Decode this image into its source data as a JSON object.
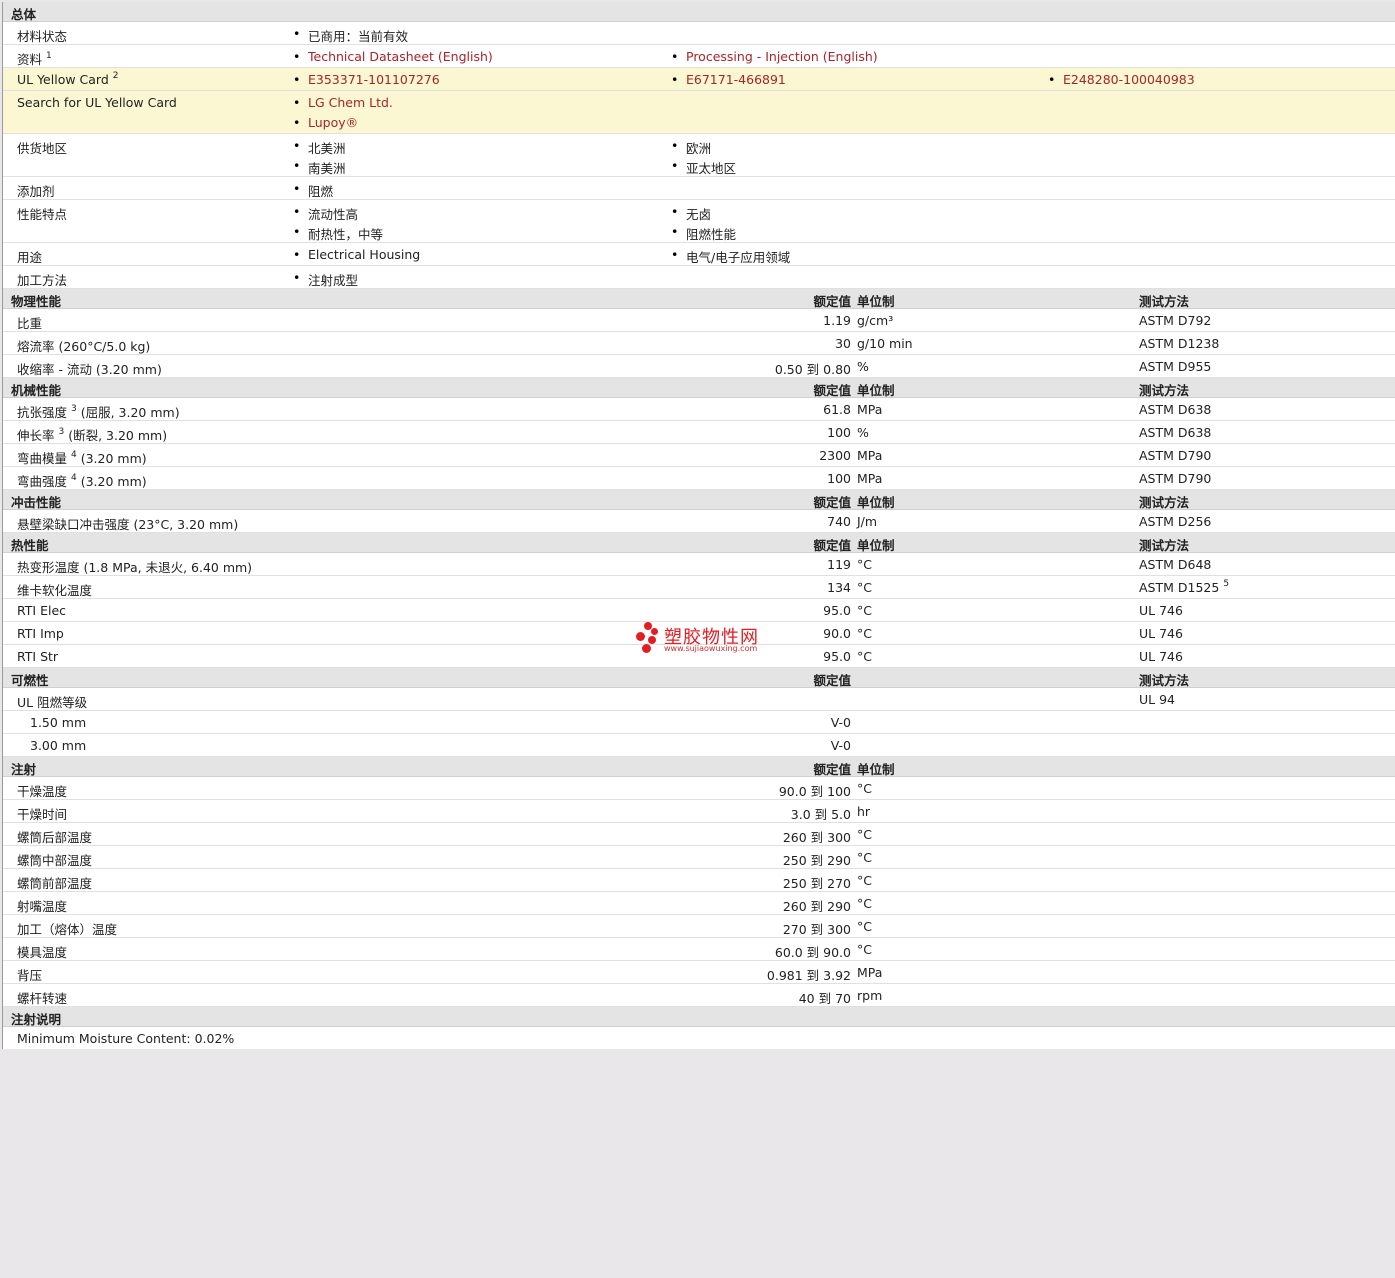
{
  "general": {
    "title": "总体",
    "status_label": "材料状态",
    "status_value": "已商用：当前有效",
    "docs_label": "资料",
    "docs_sup": "1",
    "docs": [
      "Technical Datasheet (English)",
      "Processing - Injection (English)"
    ],
    "ulcard_label": "UL Yellow Card",
    "ulcard_sup": "2",
    "ulcards": [
      "E353371-101107276",
      "E67171-466891",
      "E248280-100040983"
    ],
    "search_label": "Search for UL Yellow Card",
    "search_links": [
      "LG Chem Ltd.",
      "Lupoy®"
    ],
    "region_label": "供货地区",
    "regions": [
      "北美洲",
      "欧洲",
      "南美洲",
      "亚太地区"
    ],
    "additive_label": "添加剂",
    "additive": "阻燃",
    "features_label": "性能特点",
    "features": [
      "流动性高",
      "无卤",
      "耐热性，中等",
      "阻燃性能"
    ],
    "uses_label": "用途",
    "uses": [
      "Electrical Housing",
      "电气/电子应用领域"
    ],
    "process_label": "加工方法",
    "process": "注射成型"
  },
  "headers": {
    "value": "额定值",
    "unit": "单位制",
    "method": "测试方法"
  },
  "physical": {
    "title": "物理性能",
    "rows": [
      {
        "label": "比重",
        "value": "1.19",
        "unit": "g/cm³",
        "method": "ASTM D792"
      },
      {
        "label": "熔流率  (260°C/5.0 kg)",
        "value": "30",
        "unit": "g/10 min",
        "method": "ASTM D1238"
      },
      {
        "label": "收缩率  - 流动  (3.20 mm)",
        "value": "0.50 到  0.80",
        "unit": "%",
        "method": "ASTM D955"
      }
    ]
  },
  "mechanical": {
    "title": "机械性能",
    "rows": [
      {
        "label": "抗张强度",
        "sup": "3",
        "cond": "(屈服, 3.20 mm)",
        "value": "61.8",
        "unit": "MPa",
        "method": "ASTM D638"
      },
      {
        "label": "伸长率",
        "sup": "3",
        "cond": "(断裂, 3.20 mm)",
        "value": "100",
        "unit": "%",
        "method": "ASTM D638"
      },
      {
        "label": "弯曲模量",
        "sup": "4",
        "cond": "(3.20 mm)",
        "value": "2300",
        "unit": "MPa",
        "method": "ASTM D790"
      },
      {
        "label": "弯曲强度",
        "sup": "4",
        "cond": "(3.20 mm)",
        "value": "100",
        "unit": "MPa",
        "method": "ASTM D790"
      }
    ]
  },
  "impact": {
    "title": "冲击性能",
    "rows": [
      {
        "label": "悬壁梁缺口冲击强度  (23°C, 3.20 mm)",
        "value": "740",
        "unit": "J/m",
        "method": "ASTM D256"
      }
    ]
  },
  "thermal": {
    "title": "热性能",
    "rows": [
      {
        "label": "热变形温度  (1.8 MPa, 未退火, 6.40 mm)",
        "value": "119",
        "unit": "°C",
        "method": "ASTM D648"
      },
      {
        "label": "维卡软化温度",
        "value": "134",
        "unit": "°C",
        "method": "ASTM D1525",
        "method_sup": "5"
      },
      {
        "label": "RTI Elec",
        "value": "95.0",
        "unit": "°C",
        "method": "UL 746"
      },
      {
        "label": "RTI Imp",
        "value": "90.0",
        "unit": "°C",
        "method": "UL 746"
      },
      {
        "label": "RTI Str",
        "value": "95.0",
        "unit": "°C",
        "method": "UL 746"
      }
    ]
  },
  "flammability": {
    "title": "可燃性",
    "label": "UL 阻燃等级",
    "method": "UL 94",
    "rows": [
      {
        "label": "1.50 mm",
        "value": "V-0"
      },
      {
        "label": "3.00 mm",
        "value": "V-0"
      }
    ]
  },
  "injection": {
    "title": "注射",
    "rows": [
      {
        "label": "干燥温度",
        "value": "90.0 到  100",
        "unit": "°C"
      },
      {
        "label": "干燥时间",
        "value": "3.0 到  5.0",
        "unit": "hr"
      },
      {
        "label": "螺筒后部温度",
        "value": "260 到  300",
        "unit": "°C"
      },
      {
        "label": "螺筒中部温度",
        "value": "250 到  290",
        "unit": "°C"
      },
      {
        "label": "螺筒前部温度",
        "value": "250 到  270",
        "unit": "°C"
      },
      {
        "label": "射嘴温度",
        "value": "260 到  290",
        "unit": "°C"
      },
      {
        "label": "加工（熔体）温度",
        "value": "270 到  300",
        "unit": "°C"
      },
      {
        "label": "模具温度",
        "value": "60.0 到  90.0",
        "unit": "°C"
      },
      {
        "label": "背压",
        "value": "0.981 到  3.92",
        "unit": "MPa"
      },
      {
        "label": "螺杆转速",
        "value": "40 到  70",
        "unit": "rpm"
      }
    ]
  },
  "notes": {
    "title": "注射说明",
    "text": "Minimum Moisture Content: 0.02%"
  },
  "watermark": {
    "name": "塑胶物性网",
    "url": "www.sujiaowuxing.com",
    "color": "#e41d22"
  },
  "colors": {
    "link": "#a3262a",
    "highlight": "#fbf7d2",
    "section": "#e4e4e4"
  }
}
